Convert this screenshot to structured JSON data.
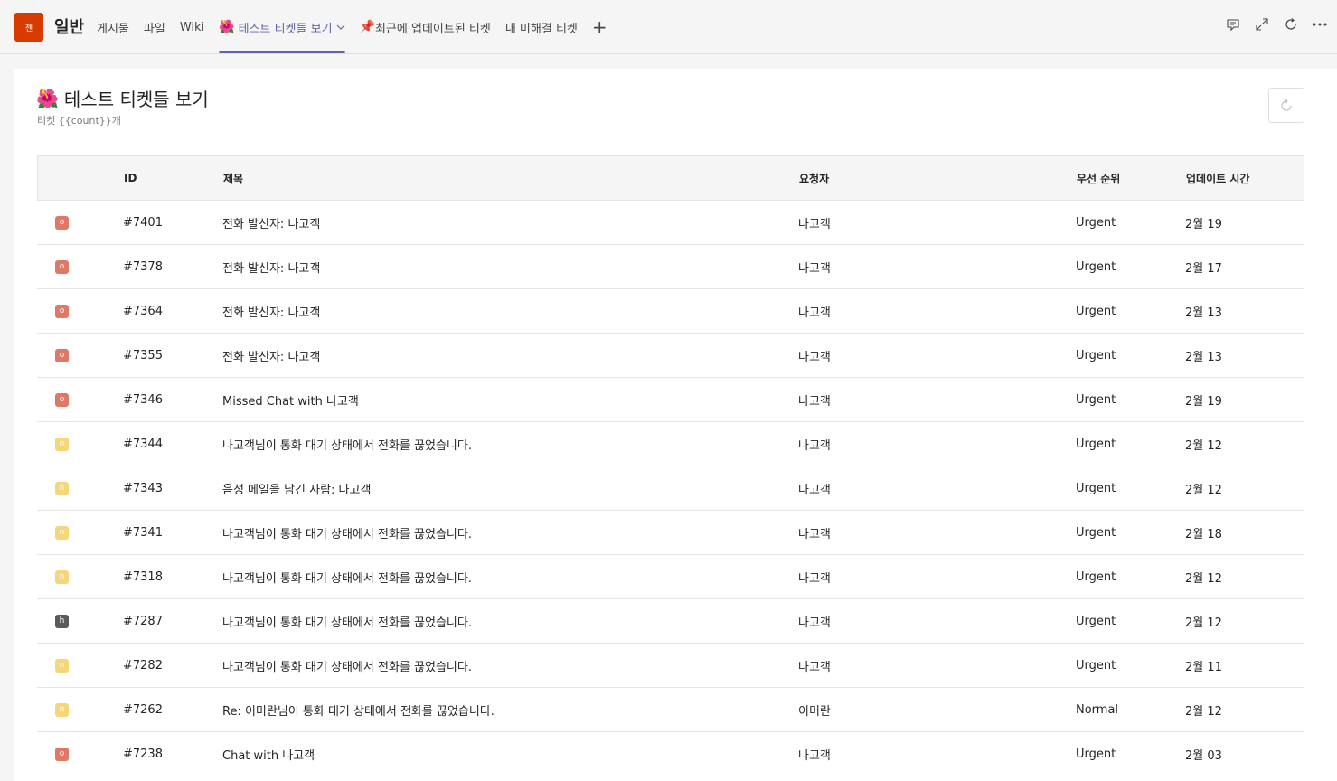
{
  "team": {
    "avatar_text": "젠",
    "channel_name": "일반"
  },
  "tabs": [
    {
      "label": "게시물",
      "emoji": "",
      "active": false
    },
    {
      "label": "파일",
      "emoji": "",
      "active": false
    },
    {
      "label": "Wiki",
      "emoji": "",
      "active": false
    },
    {
      "label": "테스트 티켓들 보기",
      "emoji": "🌺",
      "active": true
    },
    {
      "label": "최근에 업데이트된 티켓",
      "emoji": "📌",
      "active": false
    },
    {
      "label": "내 미해결 티켓",
      "emoji": "",
      "active": false
    }
  ],
  "add_tab_label": "+",
  "page": {
    "title_emoji": "🌺",
    "title": "테스트 티켓들 보기",
    "subtitle": "티켓 {{count}}개"
  },
  "table": {
    "headers": {
      "status": "",
      "id": "ID",
      "title": "제목",
      "requester": "요청자",
      "priority": "우선 순위",
      "updated": "업데이트 시간"
    },
    "rows": [
      {
        "status": "o",
        "id": "#7401",
        "title": "전화 발신자: 나고객",
        "requester": "나고객",
        "priority": "Urgent",
        "updated": "2월 19"
      },
      {
        "status": "o",
        "id": "#7378",
        "title": "전화 발신자: 나고객",
        "requester": "나고객",
        "priority": "Urgent",
        "updated": "2월 17"
      },
      {
        "status": "o",
        "id": "#7364",
        "title": "전화 발신자: 나고객",
        "requester": "나고객",
        "priority": "Urgent",
        "updated": "2월 13"
      },
      {
        "status": "o",
        "id": "#7355",
        "title": "전화 발신자: 나고객",
        "requester": "나고객",
        "priority": "Urgent",
        "updated": "2월 13"
      },
      {
        "status": "o",
        "id": "#7346",
        "title": "Missed Chat with 나고객",
        "requester": "나고객",
        "priority": "Urgent",
        "updated": "2월 19"
      },
      {
        "status": "n",
        "id": "#7344",
        "title": "나고객님이 통화 대기 상태에서 전화를 끊었습니다.",
        "requester": "나고객",
        "priority": "Urgent",
        "updated": "2월 12"
      },
      {
        "status": "n",
        "id": "#7343",
        "title": "음성 메일을 남긴 사람: 나고객",
        "requester": "나고객",
        "priority": "Urgent",
        "updated": "2월 12"
      },
      {
        "status": "n",
        "id": "#7341",
        "title": "나고객님이 통화 대기 상태에서 전화를 끊었습니다.",
        "requester": "나고객",
        "priority": "Urgent",
        "updated": "2월 18"
      },
      {
        "status": "n",
        "id": "#7318",
        "title": "나고객님이 통화 대기 상태에서 전화를 끊었습니다.",
        "requester": "나고객",
        "priority": "Urgent",
        "updated": "2월 12"
      },
      {
        "status": "h",
        "id": "#7287",
        "title": "나고객님이 통화 대기 상태에서 전화를 끊었습니다.",
        "requester": "나고객",
        "priority": "Urgent",
        "updated": "2월 12"
      },
      {
        "status": "n",
        "id": "#7282",
        "title": "나고객님이 통화 대기 상태에서 전화를 끊었습니다.",
        "requester": "나고객",
        "priority": "Urgent",
        "updated": "2월 11"
      },
      {
        "status": "n",
        "id": "#7262",
        "title": "Re: 이미란님이 통화 대기 상태에서 전화를 끊었습니다.",
        "requester": "이미란",
        "priority": "Normal",
        "updated": "2월 12"
      },
      {
        "status": "o",
        "id": "#7238",
        "title": "Chat with 나고객",
        "requester": "나고객",
        "priority": "Urgent",
        "updated": "2월 03"
      }
    ]
  },
  "icons": {
    "conversation": "conversation-icon",
    "expand": "expand-icon",
    "reload": "reload-icon",
    "more": "more-icon",
    "refresh": "refresh-icon",
    "chevron": "chevron-down-icon"
  },
  "colors": {
    "accent": "#6264a7",
    "team_avatar": "#d83b01",
    "status_open": "#e07866",
    "status_new": "#f5d77a",
    "status_hold": "#5a5a5a"
  }
}
